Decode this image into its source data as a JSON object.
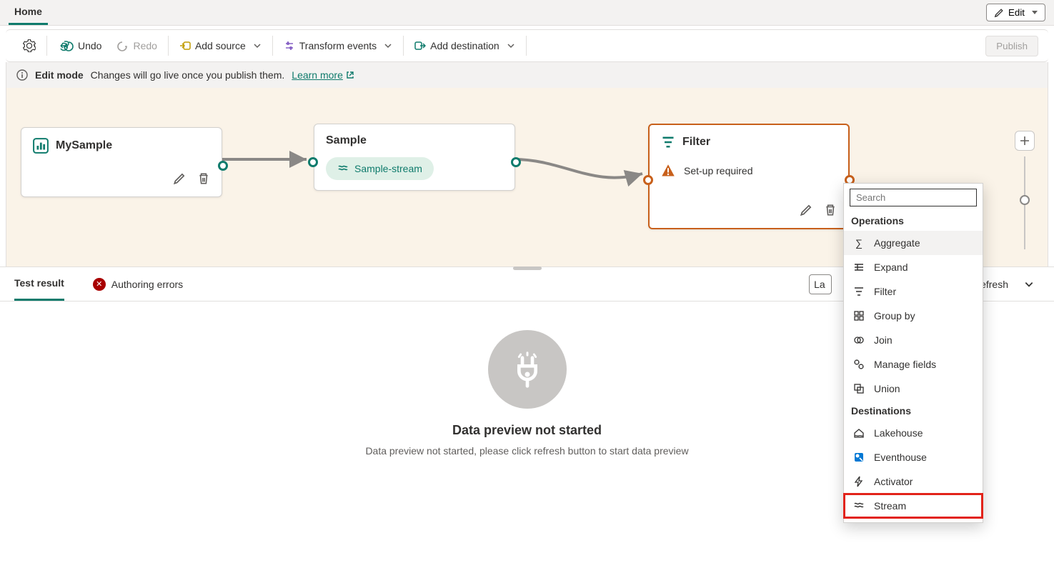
{
  "ribbon": {
    "home": "Home",
    "edit": "Edit"
  },
  "toolbar": {
    "undo": "Undo",
    "redo": "Redo",
    "add_source": "Add source",
    "transform": "Transform events",
    "add_dest": "Add destination",
    "publish": "Publish"
  },
  "editbar": {
    "mode": "Edit mode",
    "desc": "Changes will go live once you publish them.",
    "learn": "Learn more"
  },
  "nodes": {
    "mysample": {
      "title": "MySample"
    },
    "sample": {
      "title": "Sample",
      "stream": "Sample-stream"
    },
    "filter": {
      "title": "Filter",
      "warn": "Set-up required"
    }
  },
  "bottom": {
    "tab_result": "Test result",
    "tab_errors": "Authoring errors",
    "last": "La",
    "refresh": "efresh",
    "empty_title": "Data preview not started",
    "empty_desc": "Data preview not started, please click refresh button to start data preview"
  },
  "menu": {
    "search_placeholder": "Search",
    "ops": "Operations",
    "dest": "Destinations",
    "items": {
      "aggregate": "Aggregate",
      "expand": "Expand",
      "filter": "Filter",
      "groupby": "Group by",
      "join": "Join",
      "manage": "Manage fields",
      "union": "Union",
      "lakehouse": "Lakehouse",
      "eventhouse": "Eventhouse",
      "activator": "Activator",
      "stream": "Stream"
    }
  }
}
